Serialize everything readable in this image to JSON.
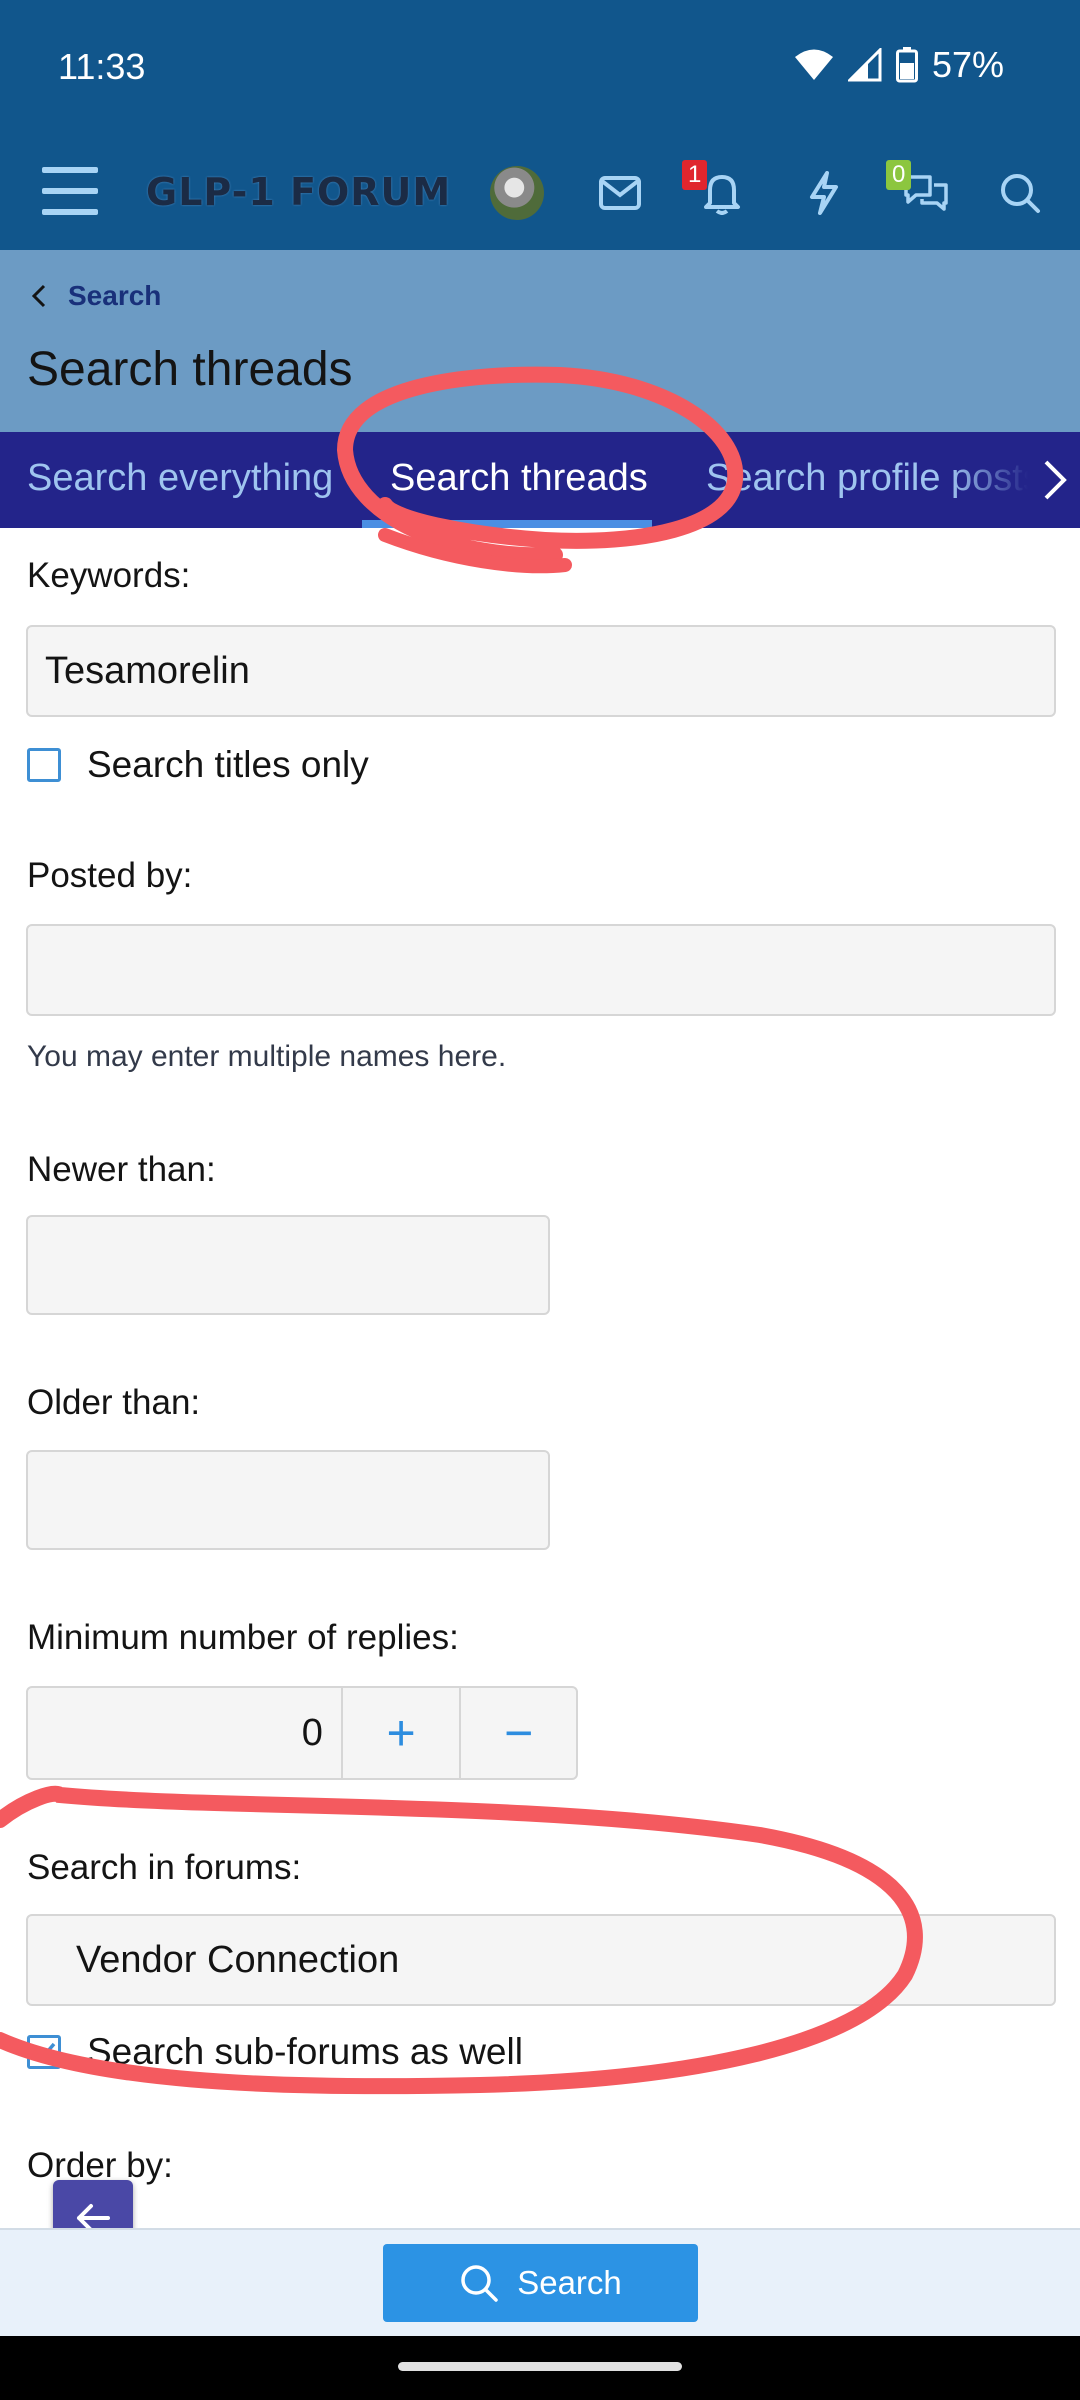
{
  "status": {
    "time": "11:33",
    "battery": "57%"
  },
  "header": {
    "logo": "GLP-1 FORUM",
    "alerts_badge": "1",
    "conversations_badge": "0",
    "icons": [
      "menu-icon",
      "avatar",
      "mail-icon",
      "bell-icon",
      "lightning-icon",
      "chat-icon",
      "search-icon"
    ]
  },
  "breadcrumb": {
    "label": "Search"
  },
  "page": {
    "title": "Search threads"
  },
  "tabs": [
    {
      "label": "Search everything"
    },
    {
      "label": "Search threads",
      "active": true
    },
    {
      "label": "Search profile posts"
    }
  ],
  "form": {
    "keywords_label": "Keywords:",
    "keywords_value": "Tesamorelin",
    "titles_only_label": "Search titles only",
    "titles_only_checked": false,
    "posted_by_label": "Posted by:",
    "posted_by_value": "",
    "posted_by_hint": "You may enter multiple names here.",
    "newer_than_label": "Newer than:",
    "older_than_label": "Older than:",
    "min_replies_label": "Minimum number of replies:",
    "min_replies_value": "0",
    "plus": "+",
    "minus": "−",
    "forums_label": "Search in forums:",
    "forums_value": "Vendor Connection",
    "subforums_label": "Search sub-forums as well",
    "subforums_checked": true,
    "order_by_label": "Order by:"
  },
  "footer": {
    "search_button": "Search"
  },
  "colors": {
    "header": "#11568c",
    "titlebar": "#6c9bc4",
    "tabs": "#23248a",
    "accent": "#2c93e4",
    "annotation": "#f45a5f"
  }
}
